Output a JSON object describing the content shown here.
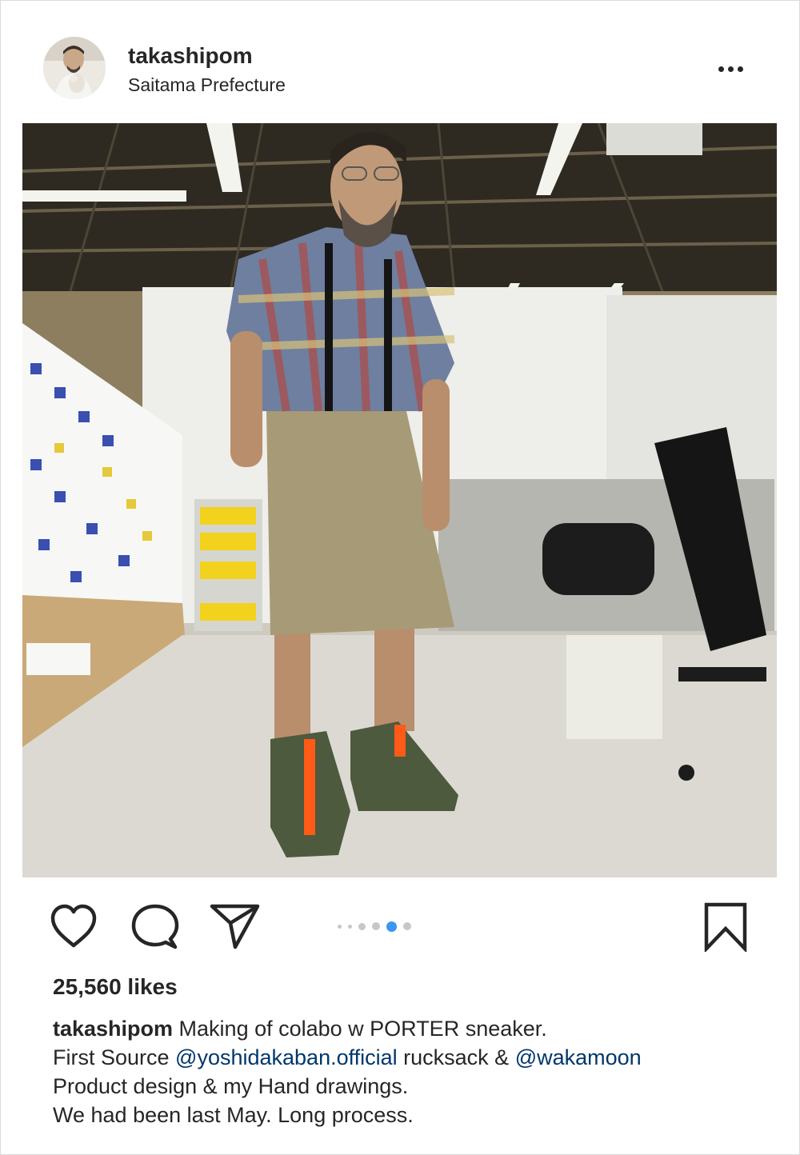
{
  "post": {
    "username": "takashipom",
    "location": "Saitama Prefecture"
  },
  "icons": {
    "more": "more-options-icon",
    "like": "heart-icon",
    "comment": "comment-bubble-icon",
    "share": "paper-plane-icon",
    "save": "bookmark-icon"
  },
  "carousel": {
    "total": 6,
    "active_index": 4
  },
  "likes_text": "25,560 likes",
  "caption": {
    "username": "takashipom",
    "line1": " Making of colabo w PORTER sneaker.",
    "line2_prefix": "First Source ",
    "mention1": "@yoshidakaban.official",
    "line2_middle": " rucksack & ",
    "mention2": "@wakamoon",
    "line3": "Product design & my Hand drawings.",
    "line4": "We had been last May. Long process."
  },
  "colors": {
    "text": "#262626",
    "mention": "#00376b",
    "dot_active": "#3897f0",
    "dot_inactive": "#c7c7c7"
  }
}
